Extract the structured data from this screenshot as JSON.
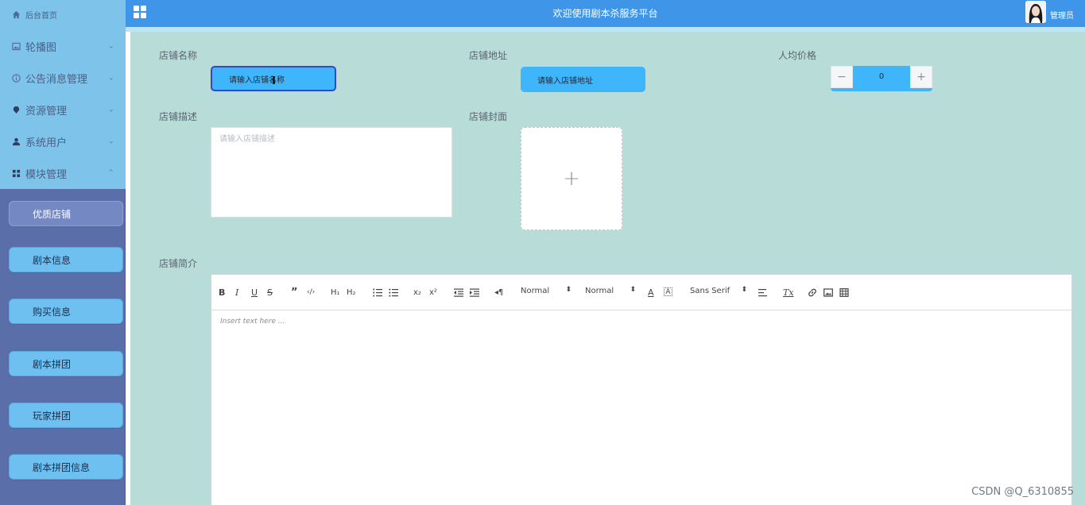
{
  "header": {
    "title": "欢迎使用剧本杀服务平台",
    "admin_name": "管理员"
  },
  "sidebar": {
    "home": "后台首页",
    "items": [
      {
        "label": "轮播图",
        "icon": "image-icon"
      },
      {
        "label": "公告消息管理",
        "icon": "info-icon"
      },
      {
        "label": "资源管理",
        "icon": "pin-icon"
      },
      {
        "label": "系统用户",
        "icon": "user-icon"
      },
      {
        "label": "模块管理",
        "icon": "grid-icon",
        "expanded": true
      }
    ],
    "submenu": [
      {
        "label": "优质店铺",
        "active": true
      },
      {
        "label": "剧本信息"
      },
      {
        "label": "购买信息"
      },
      {
        "label": "剧本拼团"
      },
      {
        "label": "玩家拼团"
      },
      {
        "label": "剧本拼团信息"
      }
    ]
  },
  "form": {
    "name_label": "店铺名称",
    "name_value": "请输入店铺名称",
    "address_label": "店铺地址",
    "address_value": "请输入店铺地址",
    "price_label": "人均价格",
    "price_value": "0",
    "price_minus": "−",
    "price_plus": "+",
    "desc_label": "店铺描述",
    "desc_placeholder": "请输入店铺描述",
    "cover_label": "店铺封面",
    "cover_plus": "+",
    "intro_label": "店铺简介"
  },
  "editor": {
    "header_select": "Normal",
    "size_select": "Normal",
    "font_select": "Sans Serif",
    "placeholder": "Insert text here ..."
  },
  "watermark": "CSDN @Q_6310855",
  "colors": {
    "header": "#3f96e8",
    "content_bg": "#b8ddd8",
    "input_fill": "#3fb6fb",
    "sidebar_dark": "#5a6faa",
    "sidebar_light": "#7ec3ea"
  }
}
